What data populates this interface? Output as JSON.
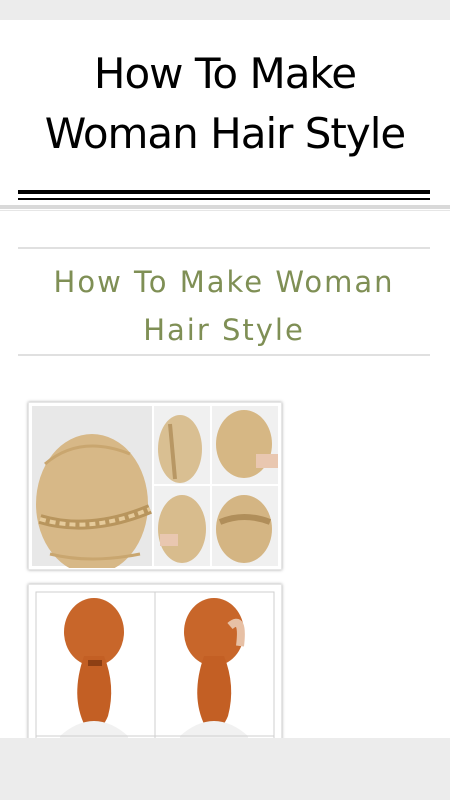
{
  "header": {
    "title": "How To Make\nWoman Hair Style"
  },
  "article": {
    "title": "How To Make Woman\nHair Style"
  },
  "images": [
    {
      "icon": "braided-hairstyle-steps-image"
    },
    {
      "icon": "ponytail-hairstyle-steps-image"
    }
  ],
  "colors": {
    "title_text": "#000000",
    "article_title": "#7f8f55",
    "hair_blonde": "#d8b98a",
    "hair_red": "#c8662a"
  }
}
